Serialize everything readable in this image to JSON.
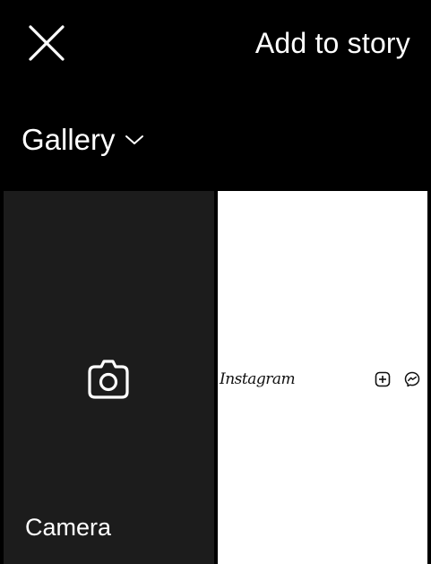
{
  "header": {
    "close_icon": "close-x-icon",
    "title": "Add to story"
  },
  "gallery": {
    "selector_label": "Gallery",
    "chevron_icon": "chevron-down-icon"
  },
  "tiles": {
    "camera": {
      "icon": "camera-icon",
      "label": "Camera",
      "background": "#1c1c1c"
    },
    "photo": {
      "wordmark": "Instagram",
      "icons": [
        "add-square-icon",
        "messenger-icon"
      ],
      "background": "#ffffff"
    }
  },
  "colors": {
    "background": "#000000",
    "text": "#ffffff"
  }
}
